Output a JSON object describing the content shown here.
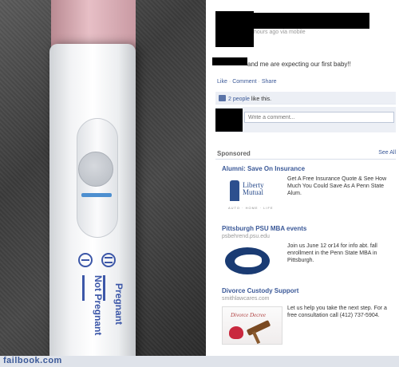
{
  "post": {
    "timestamp": "hours ago via mobile",
    "status_text": "and me are expecting our first baby!!",
    "actions": [
      "Like",
      "Comment",
      "Share"
    ],
    "likes_text": "2 people",
    "likes_suffix": "like this.",
    "comment_placeholder": "Write a comment..."
  },
  "photo": {
    "test_labels": [
      "Pregnant",
      "Not Pregnant"
    ]
  },
  "sidebar": {
    "heading": "Sponsored",
    "see_all": "See All",
    "ads": [
      {
        "title": "Alumni: Save On Insurance",
        "url": "",
        "body": "Get A Free Insurance Quote & See How Much You Could Save As A Penn State Alum.",
        "image_text": "Liberty Mutual",
        "image_subtext": "AUTO · HOME · LIFE"
      },
      {
        "title": "Pittsburgh PSU MBA events",
        "url": "psbehrend.psu.edu",
        "body": "Join us June 12 or14 for info abt. fall enrollment in the Penn State MBA in Pittsburgh."
      },
      {
        "title": "Divorce Custody Support",
        "url": "smithlawcares.com",
        "body": "Let us help you take the next step. For a free consultation call (412) 737-5904.",
        "image_text": "Divorce Decree"
      }
    ]
  },
  "footer": {
    "brand": "failbook.com"
  },
  "colors": {
    "link": "#3b5998",
    "test_blue": "#3c57a8",
    "cap_pink": "#e7bfc6"
  }
}
